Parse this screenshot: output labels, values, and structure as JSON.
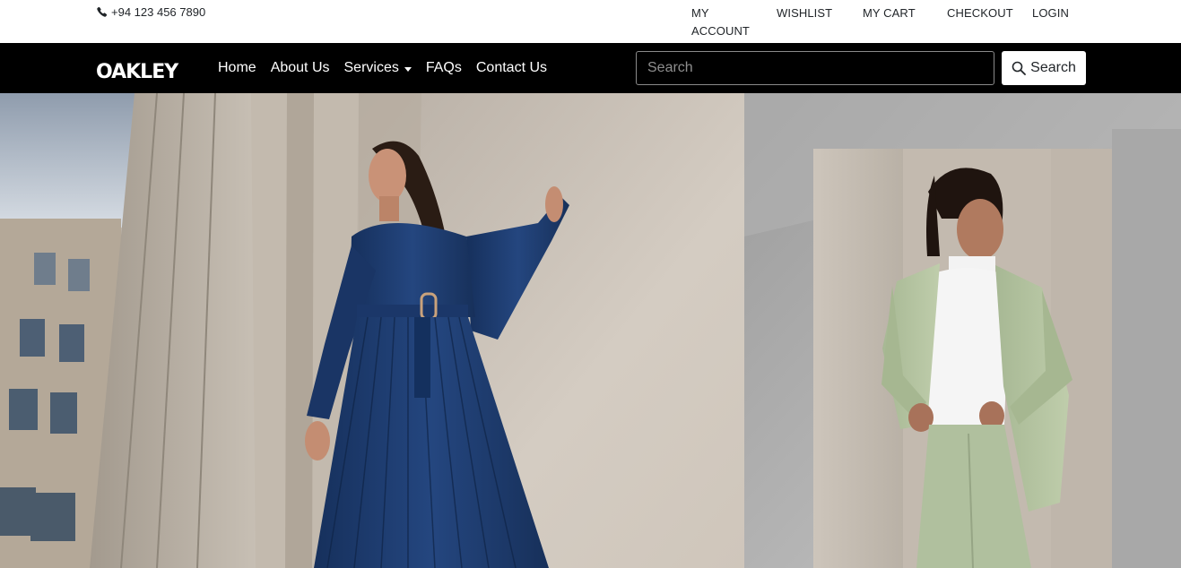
{
  "topbar": {
    "phone": "+94 123 456 7890",
    "links": {
      "account": "MY ACCOUNT",
      "wishlist": "WISHLIST",
      "cart": "MY CART",
      "checkout": "CHECKOUT",
      "login": "LOGIN"
    }
  },
  "navbar": {
    "logo": "OAKLEY",
    "links": {
      "home": "Home",
      "about": "About Us",
      "services": "Services",
      "faqs": "FAQs",
      "contact": "Contact Us"
    },
    "search": {
      "placeholder": "Search",
      "button_label": "Search"
    }
  },
  "colors": {
    "navbar_bg": "#000000",
    "topbar_bg": "#ffffff",
    "dress_blue": "#1e3b6e",
    "suit_green": "#b3c3a0"
  },
  "icons": {
    "phone": "phone-icon",
    "search": "search-icon",
    "dropdown": "caret-down-icon"
  }
}
